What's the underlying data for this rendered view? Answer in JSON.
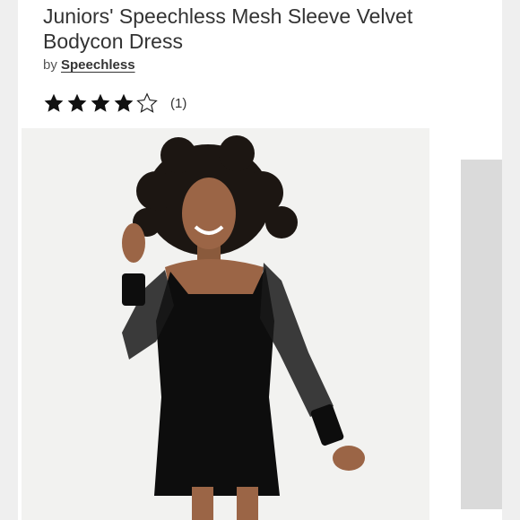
{
  "product": {
    "title": "Juniors' Speechless Mesh Sleeve Velvet Bodycon Dress",
    "by_prefix": "by",
    "brand": "Speechless",
    "rating": {
      "value": 4,
      "max": 5,
      "count_label": "(1)"
    }
  },
  "images": {
    "main": {
      "icon": "product-photo",
      "description_color": "#111111"
    },
    "next_thumbnail": {
      "icon": "thumbnail-placeholder"
    }
  },
  "colors": {
    "text": "#333333",
    "star_fill": "#111111",
    "background": "#ffffff",
    "photo_bg": "#f2f2f0"
  }
}
